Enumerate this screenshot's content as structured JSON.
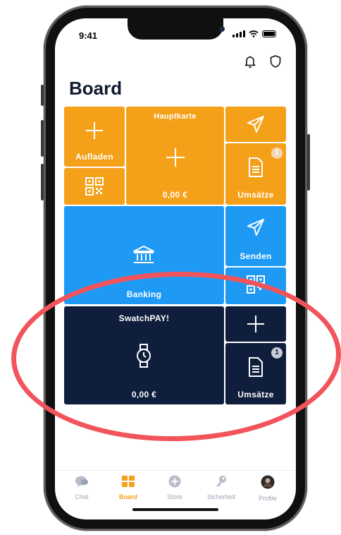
{
  "status_bar": {
    "time": "9:41"
  },
  "header": {
    "notifications_icon": "bell-icon",
    "security_icon": "shield-icon"
  },
  "page": {
    "title": "Board"
  },
  "tiles": {
    "aufladen": {
      "label": "Aufladen",
      "icon": "plus-icon"
    },
    "qr_top": {
      "icon": "qr-code-icon"
    },
    "hauptkarte": {
      "title": "Hauptkarte",
      "amount": "0,00 €",
      "icon": "plus-icon"
    },
    "send_top": {
      "icon": "send-icon"
    },
    "umsaetze_top": {
      "label": "Umsätze",
      "badge": "1",
      "icon": "document-icon"
    },
    "banking": {
      "label": "Banking",
      "icon": "bank-icon"
    },
    "senden": {
      "label": "Senden",
      "icon": "send-icon"
    },
    "qr_mid": {
      "icon": "qr-code-icon"
    },
    "swatchpay": {
      "title": "SwatchPAY!",
      "amount": "0,00 €",
      "icon": "watch-icon"
    },
    "add_swatch": {
      "icon": "plus-icon"
    },
    "umsaetze_bottom": {
      "label": "Umsätze",
      "badge": "1",
      "icon": "document-icon"
    }
  },
  "tabbar": {
    "items": [
      {
        "label": "Chat",
        "icon": "chat-icon"
      },
      {
        "label": "Board",
        "icon": "board-icon",
        "active": true
      },
      {
        "label": "Store",
        "icon": "plus-circle-icon"
      },
      {
        "label": "Sicherheit",
        "icon": "key-icon"
      },
      {
        "label": "Profile",
        "icon": "avatar-icon"
      }
    ]
  },
  "colors": {
    "orange": "#f5a019",
    "blue": "#1e9af5",
    "navy": "#0f1e3d",
    "highlight": "#f2545b"
  }
}
